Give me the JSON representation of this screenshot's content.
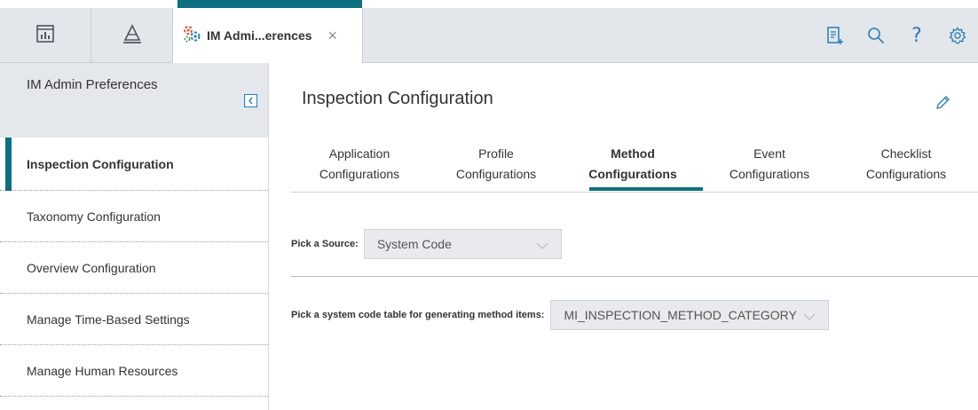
{
  "header": {
    "tab_label": "IM Admi...erences",
    "close_glyph": "×",
    "nav_icons": [
      "dashboard-icon",
      "triangle-stack-icon"
    ],
    "right_icons": [
      "clipboard-add-icon",
      "search-icon",
      "help-icon",
      "gear-icon"
    ],
    "help_glyph": "?"
  },
  "sidebar": {
    "title": "IM Admin Preferences",
    "items": [
      {
        "label": "Inspection Configuration",
        "active": true
      },
      {
        "label": "Taxonomy Configuration"
      },
      {
        "label": "Overview Configuration"
      },
      {
        "label": "Manage Time-Based Settings"
      },
      {
        "label": "Manage Human Resources"
      }
    ]
  },
  "main": {
    "title": "Inspection Configuration",
    "tabs": [
      {
        "line1": "Application",
        "line2": "Configurations"
      },
      {
        "line1": "Profile",
        "line2": "Configurations"
      },
      {
        "line1": "Method",
        "line2": "Configurations",
        "active": true
      },
      {
        "line1": "Event",
        "line2": "Configurations"
      },
      {
        "line1": "Checklist",
        "line2": "Configurations"
      }
    ],
    "source_label": "Pick a Source:",
    "source_value": "System Code",
    "table_label": "Pick a system code table for generating method items:",
    "table_value": "MI_INSPECTION_METHOD_CATEGORY"
  },
  "colors": {
    "accent": "#0e6f80",
    "header_bg": "#e3e6ea",
    "sidebar_head_bg": "#e4e7eb",
    "icon_blue": "#2a7fb8"
  }
}
